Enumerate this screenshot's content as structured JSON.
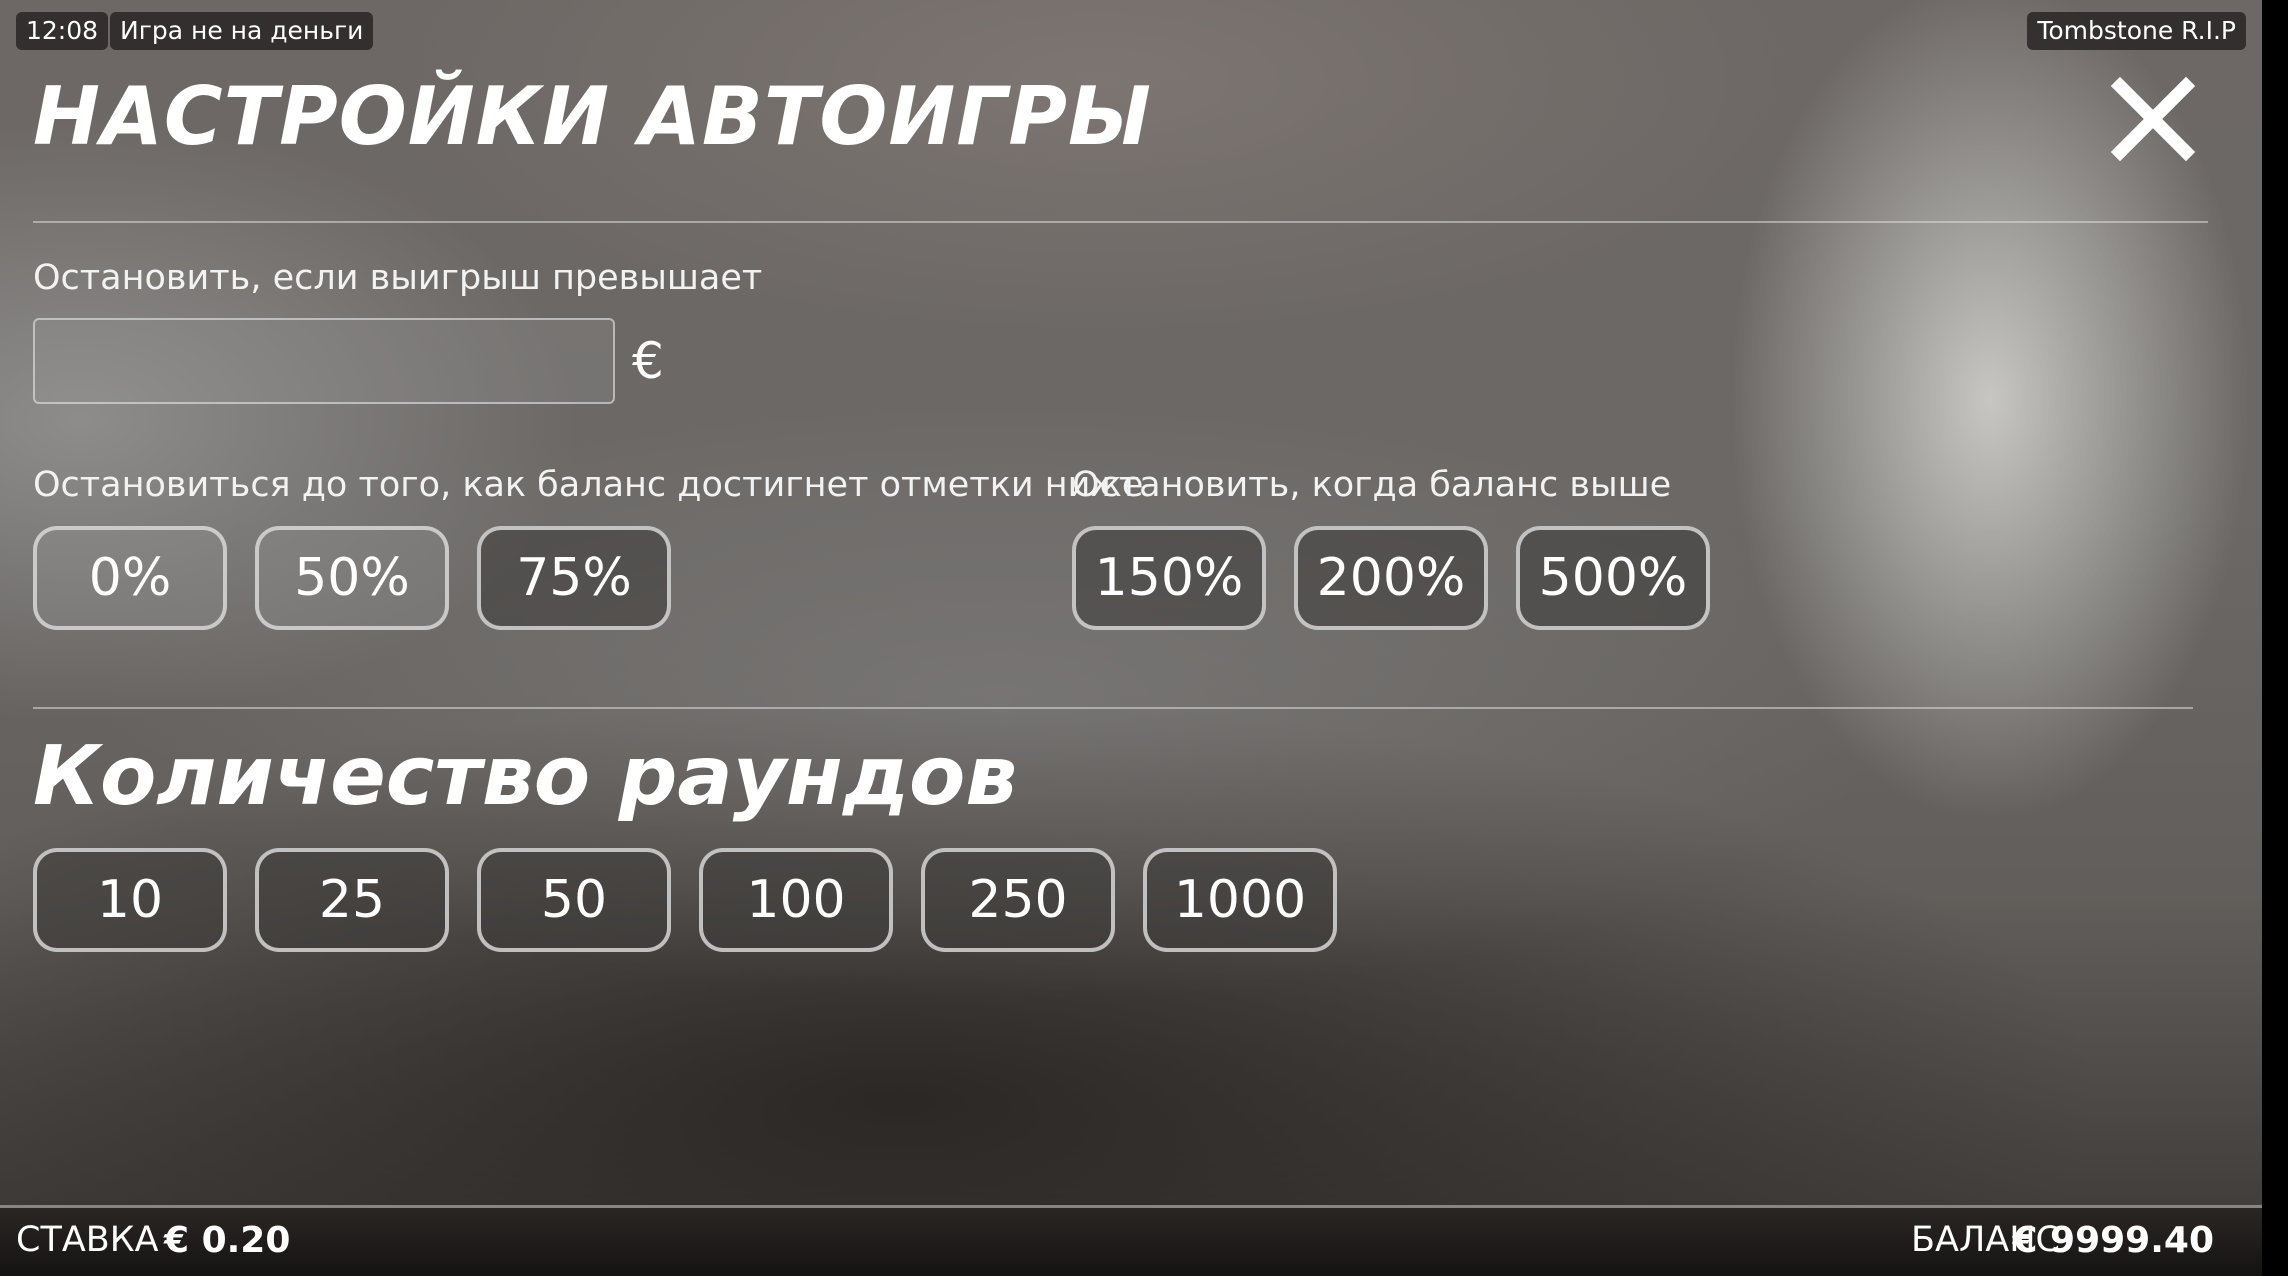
{
  "status": {
    "time": "12:08",
    "mode": "Игра не на деньги",
    "game_name": "Tombstone R.I.P"
  },
  "dialog": {
    "title": "НАСТРОЙКИ АВТОИГРЫ",
    "close_icon": "close-icon",
    "win_limit": {
      "label": "Остановить, если выигрыш превышает",
      "value": "",
      "placeholder": "",
      "currency": "€"
    },
    "loss_limit": {
      "label": "Остановиться до того, как баланс достигнет отметки ниже",
      "options": [
        "0%",
        "50%",
        "75%"
      ]
    },
    "gain_limit": {
      "label": "Остановить, когда баланс выше",
      "options": [
        "150%",
        "200%",
        "500%"
      ]
    },
    "rounds": {
      "title": "Количество раундов",
      "options": [
        "10",
        "25",
        "50",
        "100",
        "250",
        "1000"
      ]
    }
  },
  "footer": {
    "bet_label": "СТАВКА",
    "bet_value": "€ 0.20",
    "balance_label": "БАЛАНС",
    "balance_value": "€ 9999.40"
  },
  "colors": {
    "text": "#ffffff",
    "button_border": "#d7d7d7",
    "footer_bg": "#1c1918"
  }
}
